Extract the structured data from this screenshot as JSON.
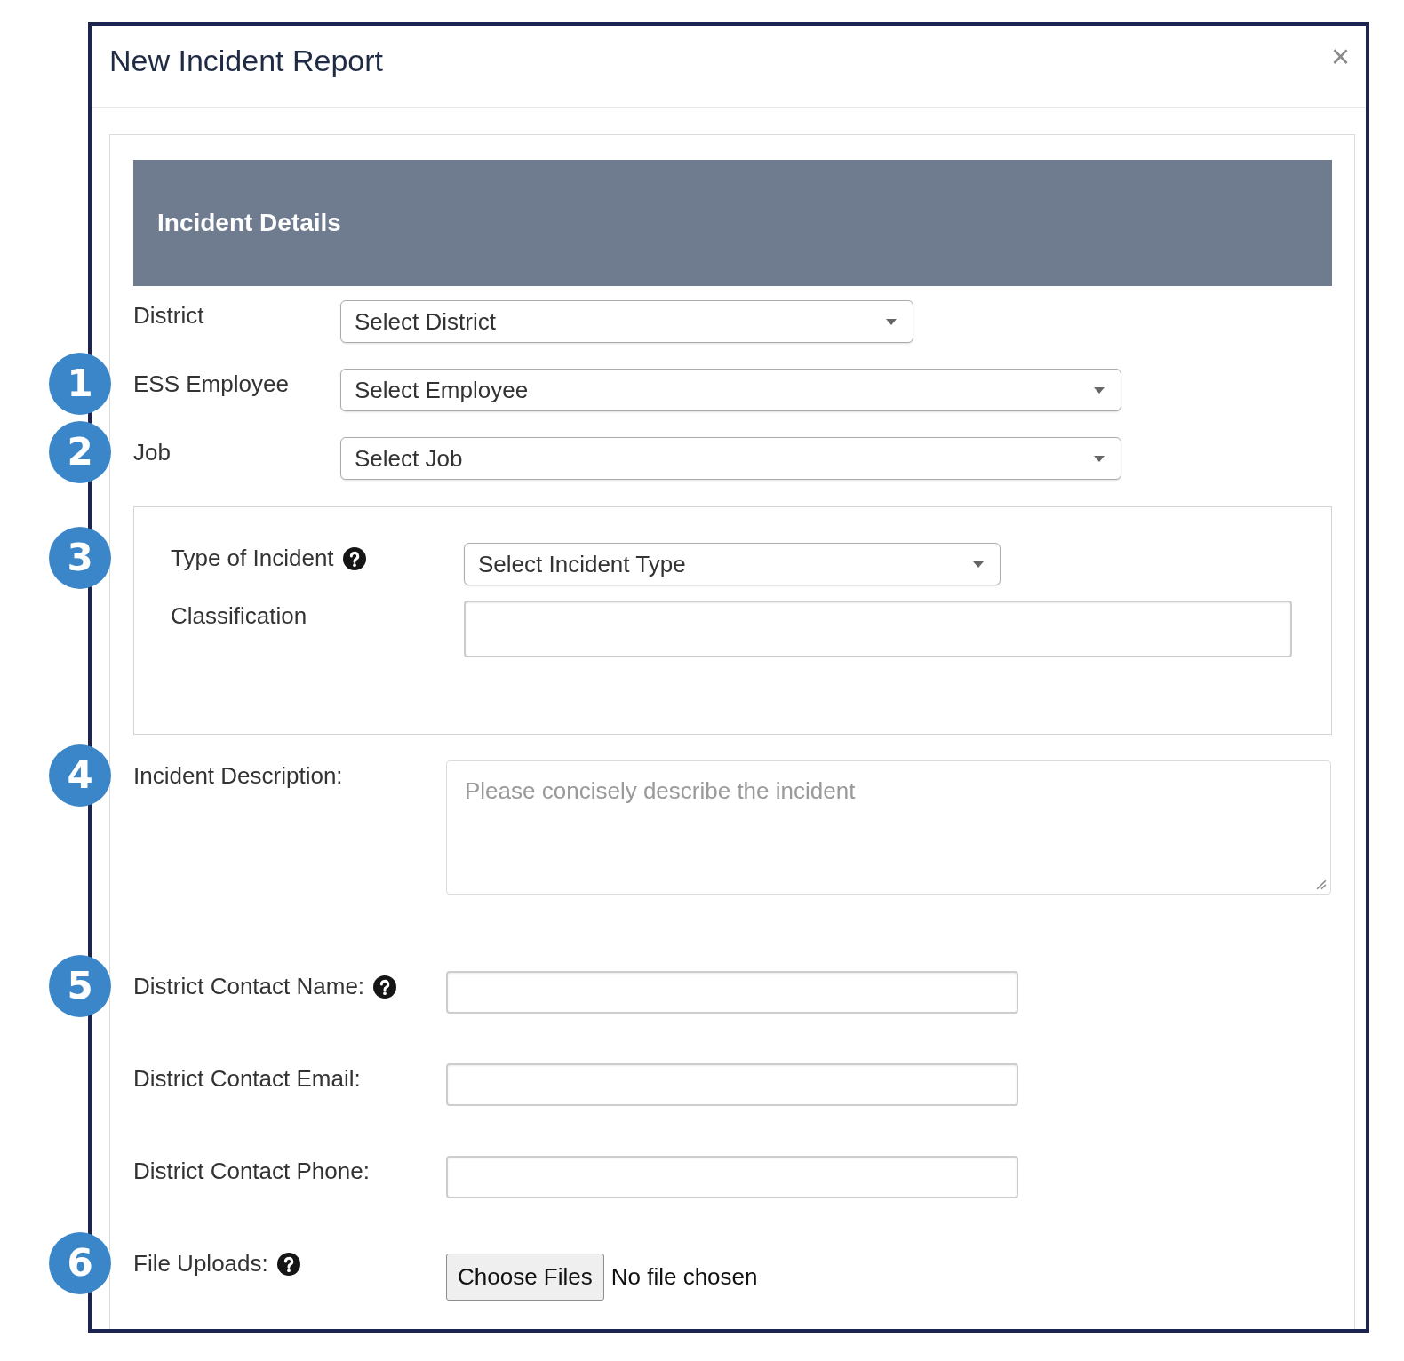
{
  "window": {
    "title": "New Incident Report",
    "close": "×"
  },
  "section": {
    "title": "Incident Details"
  },
  "fields": [
    {
      "label": "District",
      "help": false,
      "kind": "select",
      "value": "Select District"
    },
    {
      "label": "ESS Employee",
      "help": false,
      "kind": "select",
      "value": "Select Employee",
      "marker": "1"
    },
    {
      "label": "Job",
      "help": false,
      "kind": "select",
      "value": "Select Job",
      "marker": "2"
    }
  ],
  "incident_group": {
    "fields": [
      {
        "label": "Type of Incident",
        "help": true,
        "kind": "select",
        "value": "Select Incident Type",
        "marker": "3"
      },
      {
        "label": "Classification",
        "help": false,
        "kind": "text"
      }
    ]
  },
  "details": [
    {
      "label": "Incident Description:",
      "help": false,
      "kind": "textarea",
      "placeholder": "Please concisely describe the incident",
      "marker": "4"
    },
    {
      "label": "District Contact Name:",
      "help": true,
      "kind": "text",
      "marker": "5"
    },
    {
      "label": "District Contact Email:",
      "help": false,
      "kind": "text"
    },
    {
      "label": "District Contact Phone:",
      "help": false,
      "kind": "text"
    },
    {
      "label": "File Uploads:",
      "help": true,
      "kind": "file",
      "button": "Choose Files",
      "status": "No file chosen",
      "marker": "6"
    }
  ]
}
